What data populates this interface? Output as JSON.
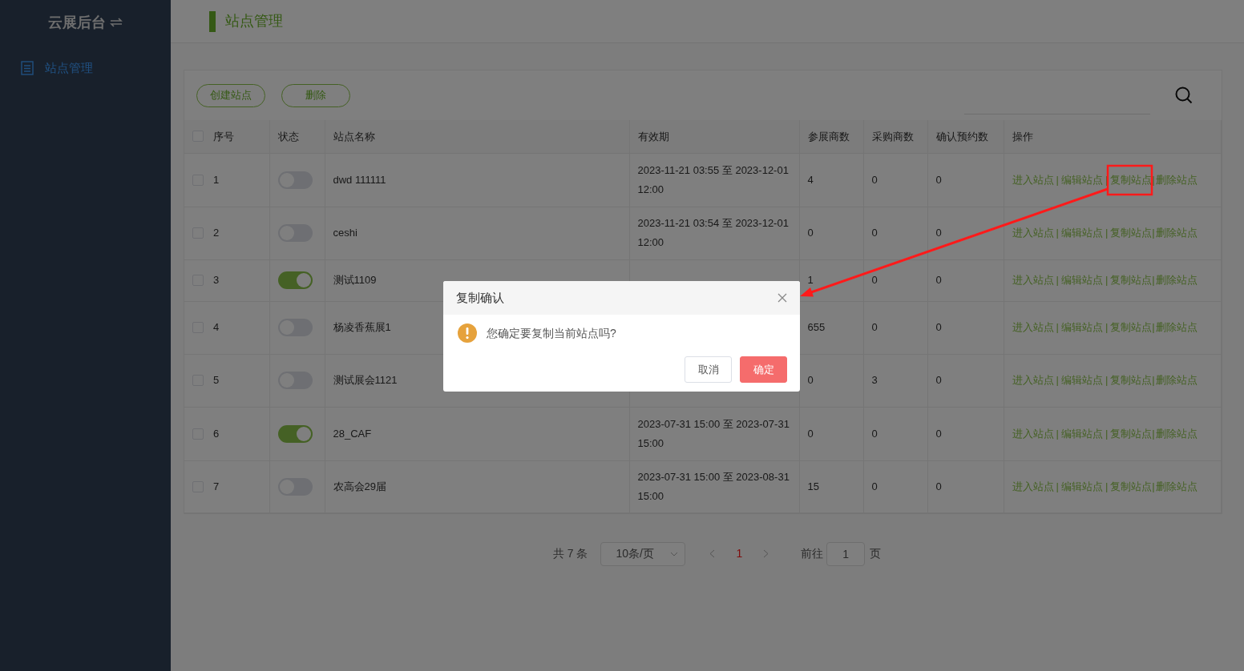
{
  "sidebar": {
    "brand": "云展后台",
    "items": [
      {
        "label": "站点管理",
        "selected": true
      }
    ]
  },
  "page_title": "站点管理",
  "toolbar": {
    "buttons": [
      "创建站点",
      "删除"
    ]
  },
  "table": {
    "columns": [
      "序号",
      "状态",
      "站点名称",
      "有效期",
      "参展商数",
      "采购商数",
      "确认预约数",
      "操作"
    ],
    "header_checked": false,
    "rows": [
      {
        "checked": false,
        "index": "1",
        "on": false,
        "name": "dwd 111111",
        "validity": "2023-11-21 03:55 至 2023-12-01 12:00",
        "exhibitors": "4",
        "buyers": "0",
        "confirmed": "0",
        "actions": [
          "进入站点",
          "编辑站点",
          "复制站点",
          "删除站点"
        ],
        "separators": [
          "|",
          "|",
          "|"
        ]
      },
      {
        "checked": false,
        "index": "2",
        "on": false,
        "name": "ceshi",
        "validity": "2023-11-21 03:54 至 2023-12-01 12:00",
        "exhibitors": "0",
        "buyers": "0",
        "confirmed": "0",
        "actions": [
          "进入站点",
          "编辑站点",
          "复制站点",
          "删除站点"
        ],
        "separators": [
          "|",
          "|",
          "|"
        ]
      },
      {
        "checked": false,
        "index": "3",
        "on": true,
        "name": "测试1109",
        "exhibitors": "1",
        "buyers": "0",
        "confirmed": "0",
        "actions": [
          "进入站点",
          "编辑站点",
          "复制站点",
          "删除站点"
        ],
        "separators": [
          "|",
          "|",
          "|"
        ]
      },
      {
        "checked": false,
        "index": "4",
        "on": false,
        "name": "杨凌香蕉展1",
        "exhibitors": "655",
        "buyers": "0",
        "confirmed": "0",
        "actions": [
          "进入站点",
          "编辑站点",
          "复制站点",
          "删除站点"
        ],
        "separators": [
          "|",
          "|",
          "|"
        ]
      },
      {
        "checked": false,
        "index": "5",
        "on": false,
        "name": "测试展会1121",
        "exhibitors": "0",
        "buyers": "3",
        "confirmed": "0",
        "actions": [
          "进入站点",
          "编辑站点",
          "复制站点",
          "删除站点"
        ],
        "separators": [
          "|",
          "|",
          "|"
        ]
      },
      {
        "checked": false,
        "index": "6",
        "on": true,
        "name": "28_CAF",
        "validity": "2023-07-31 15:00 至 2023-07-31 15:00",
        "exhibitors": "0",
        "buyers": "0",
        "confirmed": "0",
        "actions": [
          "进入站点",
          "编辑站点",
          "复制站点",
          "删除站点"
        ],
        "separators": [
          "|",
          "|",
          "|"
        ]
      },
      {
        "checked": false,
        "index": "7",
        "on": false,
        "name": "农高会29届",
        "validity": "2023-07-31 15:00 至 2023-08-31 15:00",
        "exhibitors": "15",
        "buyers": "0",
        "confirmed": "0",
        "actions": [
          "进入站点",
          "编辑站点",
          "复制站点",
          "删除站点"
        ],
        "separators": [
          "|",
          "|",
          "|"
        ]
      }
    ]
  },
  "pagination": {
    "total": "共 7 条",
    "page_size": "10条/页",
    "pages": [
      {
        "label": "1",
        "selected": true
      }
    ],
    "goto_label": "前往",
    "goto_value": "1",
    "goto_unit": "页"
  },
  "dialog": {
    "title": "复制确认",
    "message": "您确定要复制当前站点吗?",
    "buttons": [
      {
        "label": "取消",
        "kind": "default"
      },
      {
        "label": "确定",
        "kind": "primary"
      }
    ]
  }
}
